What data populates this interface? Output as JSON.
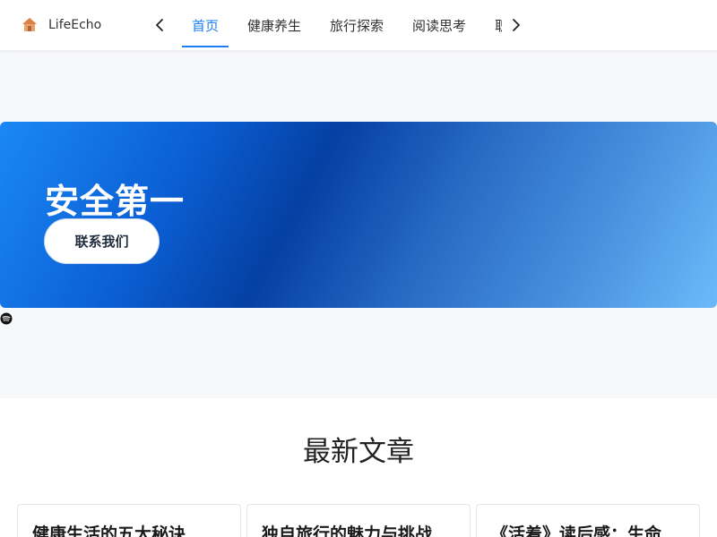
{
  "header": {
    "brand": {
      "name": "LifeEcho",
      "icon": "house-icon"
    },
    "nav_prev_icon": "chevron-left-icon",
    "nav_next_icon": "chevron-right-icon",
    "tabs": [
      {
        "label": "首页",
        "active": true
      },
      {
        "label": "健康养生",
        "active": false
      },
      {
        "label": "旅行探索",
        "active": false
      },
      {
        "label": "阅读思考",
        "active": false
      },
      {
        "label": "职场",
        "active": false
      }
    ]
  },
  "hero": {
    "title": "安全第一",
    "button_label": "联系我们"
  },
  "floating_icon": "spotify-icon",
  "articles": {
    "section_title": "最新文章",
    "cards": [
      {
        "title": "健康生活的五大秘诀"
      },
      {
        "title": "独自旅行的魅力与挑战"
      },
      {
        "title": "《活着》读后感：生命"
      }
    ]
  },
  "colors": {
    "accent": "#1d7ef0",
    "hero_gradient_start": "#1a88f5",
    "hero_gradient_mid": "#0540a3",
    "hero_gradient_end": "#6cbaf9"
  }
}
